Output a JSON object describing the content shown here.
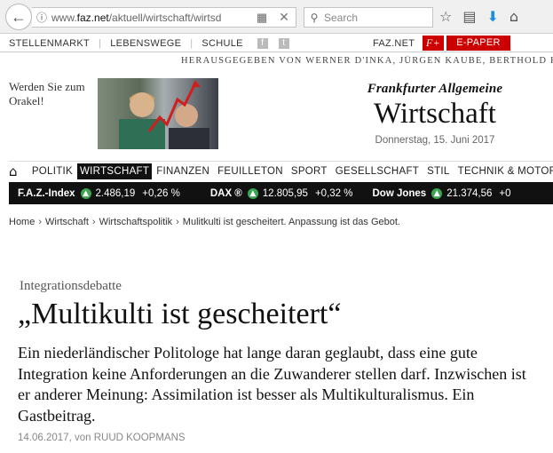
{
  "browser": {
    "url_prefix": "www.",
    "url_domain": "faz.net",
    "url_path": "/aktuell/wirtschaft/wirtsd",
    "search_placeholder": "Search"
  },
  "topnav": {
    "left": [
      "STELLENMARKT",
      "LEBENSWEGE",
      "SCHULE"
    ],
    "faz_net": "FAZ.NET",
    "fplus": "F+",
    "epaper": "E-PAPER"
  },
  "publisher_line": "HERAUSGEGEBEN VON WERNER D'INKA, JÜRGEN KAUBE, BERTHOLD KOHLER",
  "teaser": {
    "text_line1": "Werden Sie zum",
    "text_line2": "Orakel!"
  },
  "masthead": {
    "newspaper": "Frankfurter Allgemeine",
    "section": "Wirtschaft",
    "date": "Donnerstag, 15. Juni 2017"
  },
  "mainnav": {
    "items": [
      "POLITIK",
      "WIRTSCHAFT",
      "FINANZEN",
      "FEUILLETON",
      "SPORT",
      "GESELLSCHAFT",
      "STIL",
      "TECHNIK & MOTOR"
    ]
  },
  "ticker": [
    {
      "name": "F.A.Z.-Index",
      "value": "2.486,19",
      "change": "+0,26 %"
    },
    {
      "name": "DAX ®",
      "value": "12.805,95",
      "change": "+0,32 %"
    },
    {
      "name": "Dow Jones",
      "value": "21.374,56",
      "change": "+0"
    }
  ],
  "breadcrumb": [
    "Home",
    "Wirtschaft",
    "Wirtschaftspolitik",
    "Mulitkulti ist gescheitert. Anpassung ist das Gebot."
  ],
  "article": {
    "kicker": "Integrationsdebatte",
    "headline": "„Multikulti ist gescheitert“",
    "lead": "Ein niederländischer Politologe hat lange daran geglaubt, dass eine gute Integration keine Anforderungen an die Zuwanderer stellen darf. Inzwischen ist er anderer Meinung: Assimilation ist besser als Multikulturalismus. Ein Gastbeitrag.",
    "date": "14.06.2017",
    "by": ", von ",
    "author": "RUUD KOOPMANS"
  }
}
